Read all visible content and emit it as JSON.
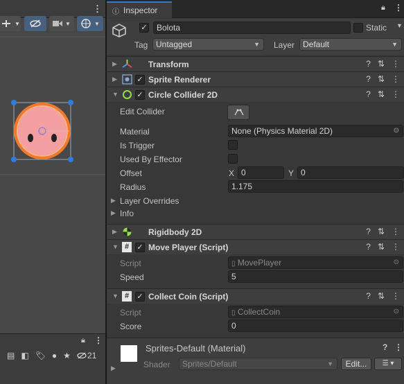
{
  "scene": {
    "toolbar": {
      "more_icon": "kebab-menu-icon"
    },
    "gizmo_buttons": [
      "move-tool-icon",
      "visibility-icon",
      "camera-icon",
      "gizmo-icon"
    ],
    "bottom_bar": {
      "count": "21"
    }
  },
  "inspector": {
    "tab_label": "Inspector",
    "object": {
      "name": "Bolota",
      "static_label": "Static",
      "tag_label": "Tag",
      "tag_value": "Untagged",
      "layer_label": "Layer",
      "layer_value": "Default"
    },
    "components": {
      "transform": {
        "title": "Transform"
      },
      "sprite_renderer": {
        "title": "Sprite Renderer"
      },
      "circle_collider": {
        "title": "Circle Collider 2D",
        "edit_collider_label": "Edit Collider",
        "material_label": "Material",
        "material_value": "None (Physics Material 2D)",
        "is_trigger_label": "Is Trigger",
        "used_by_effector_label": "Used By Effector",
        "offset_label": "Offset",
        "offset_x_label": "X",
        "offset_x": "0",
        "offset_y_label": "Y",
        "offset_y": "0",
        "radius_label": "Radius",
        "radius_value": "1.175",
        "layer_overrides_label": "Layer Overrides",
        "info_label": "Info"
      },
      "rigidbody": {
        "title": "Rigidbody 2D"
      },
      "move_player": {
        "title": "Move Player (Script)",
        "script_label": "Script",
        "script_value": "MovePlayer",
        "speed_label": "Speed",
        "speed_value": "5"
      },
      "collect_coin": {
        "title": "Collect Coin (Script)",
        "script_label": "Script",
        "script_value": "CollectCoin",
        "score_label": "Score",
        "score_value": "0"
      }
    },
    "material": {
      "title": "Sprites-Default (Material)",
      "shader_label": "Shader",
      "shader_value": "Sprites/Default",
      "edit_label": "Edit..."
    }
  },
  "colors": {
    "accent": "#3a79bb",
    "collider_green": "#8fe04a",
    "sprite_fill": "#f4a0a0",
    "collider_outline": "#f07a2a"
  }
}
